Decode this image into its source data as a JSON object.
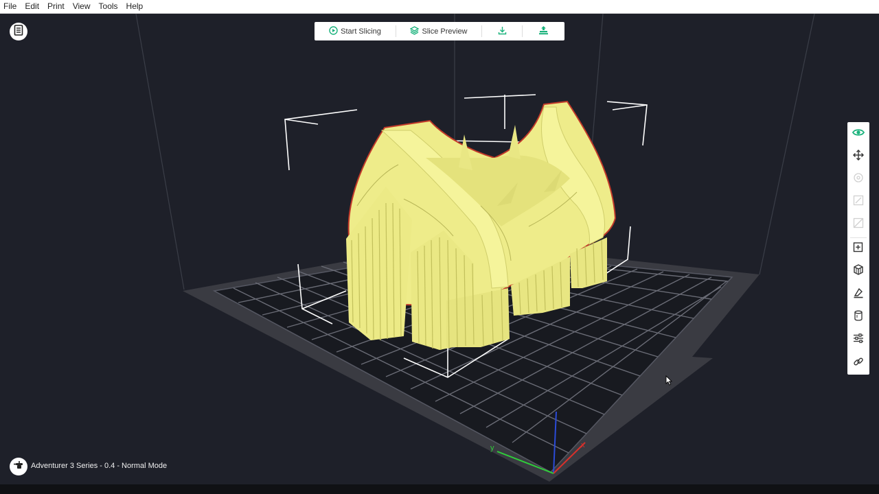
{
  "menu": [
    "File",
    "Edit",
    "Print",
    "View",
    "Tools",
    "Help"
  ],
  "toolbar": {
    "start_slicing": "Start Slicing",
    "slice_preview": "Slice Preview"
  },
  "status": {
    "printer_mode": "Adventurer 3 Series - 0.4 - Normal Mode"
  },
  "colors": {
    "accent": "#1ab27c",
    "model": "#f1f08c",
    "model_outline": "#c23a2a",
    "viewport_bg": "#1e2029",
    "build_plate": "#3a3b42"
  },
  "right_toolbar": [
    {
      "icon": "eye-icon",
      "enabled": true,
      "active": true
    },
    {
      "icon": "move-icon",
      "enabled": true
    },
    {
      "icon": "rotate-icon",
      "enabled": false
    },
    {
      "icon": "scale-icon",
      "enabled": false
    },
    {
      "icon": "mirror-icon",
      "enabled": false
    },
    {
      "icon": "add-model-icon",
      "enabled": true
    },
    {
      "icon": "cubes-icon",
      "enabled": true
    },
    {
      "icon": "support-icon",
      "enabled": true
    },
    {
      "icon": "cylinder-icon",
      "enabled": true
    },
    {
      "icon": "settings-sliders-icon",
      "enabled": true
    },
    {
      "icon": "link-icon",
      "enabled": true
    }
  ]
}
